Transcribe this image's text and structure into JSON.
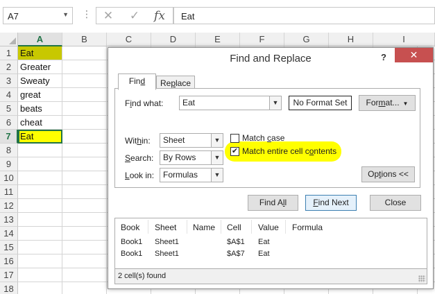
{
  "formula_bar": {
    "name_box": "A7",
    "cancel_icon": "close-x-icon",
    "enter_icon": "checkmark-icon",
    "function_label": "fx",
    "content": "Eat"
  },
  "columns": [
    "A",
    "B",
    "C",
    "D",
    "E",
    "F",
    "G",
    "H",
    "I"
  ],
  "rows": [
    "1",
    "2",
    "3",
    "4",
    "5",
    "6",
    "7",
    "8",
    "9",
    "10",
    "11",
    "12",
    "13",
    "14",
    "15",
    "16",
    "17",
    "18"
  ],
  "cells": [
    "Eat",
    "Greater",
    "Sweaty",
    "great",
    "beats",
    "cheat",
    "Eat"
  ],
  "highlight_colors": {
    "found_cell": "#c8c800",
    "yellow": "#ffff00"
  },
  "dialog": {
    "title": "Find and Replace",
    "help": "?",
    "close": "✕",
    "tabs": {
      "find_pre": "Fin",
      "find_u": "d",
      "replace_pre": "Re",
      "replace_u": "p",
      "replace_post": "lace"
    },
    "find_what_pre": "F",
    "find_what_u": "i",
    "find_what_post": "nd what:",
    "find_what_value": "Eat",
    "no_format": "No Format Set",
    "format_pre": "For",
    "format_u": "m",
    "format_post": "at...",
    "within_pre": "Wit",
    "within_u": "h",
    "within_post": "in:",
    "within_value": "Sheet",
    "search_pre": "",
    "search_u": "S",
    "search_post": "earch:",
    "search_value": "By Rows",
    "lookin_pre": "",
    "lookin_u": "L",
    "lookin_post": "ook in:",
    "lookin_value": "Formulas",
    "match_case_pre": "Match ",
    "match_case_u": "c",
    "match_case_post": "ase",
    "match_case_checked": false,
    "match_entire_pre": "Match entire cell c",
    "match_entire_u": "o",
    "match_entire_post": "ntents",
    "match_entire_checked": true,
    "options_pre": "Op",
    "options_u": "t",
    "options_post": "ions <<",
    "find_all_pre": "Find A",
    "find_all_u": "l",
    "find_all_post": "l",
    "find_next_pre": "",
    "find_next_u": "F",
    "find_next_post": "ind Next",
    "close_button": "Close",
    "results_headers": [
      "Book",
      "Sheet",
      "Name",
      "Cell",
      "Value",
      "Formula"
    ],
    "results_rows": [
      [
        "Book1",
        "Sheet1",
        "",
        "$A$1",
        "Eat",
        ""
      ],
      [
        "Book1",
        "Sheet1",
        "",
        "$A$7",
        "Eat",
        ""
      ]
    ],
    "status": "2 cell(s) found"
  }
}
